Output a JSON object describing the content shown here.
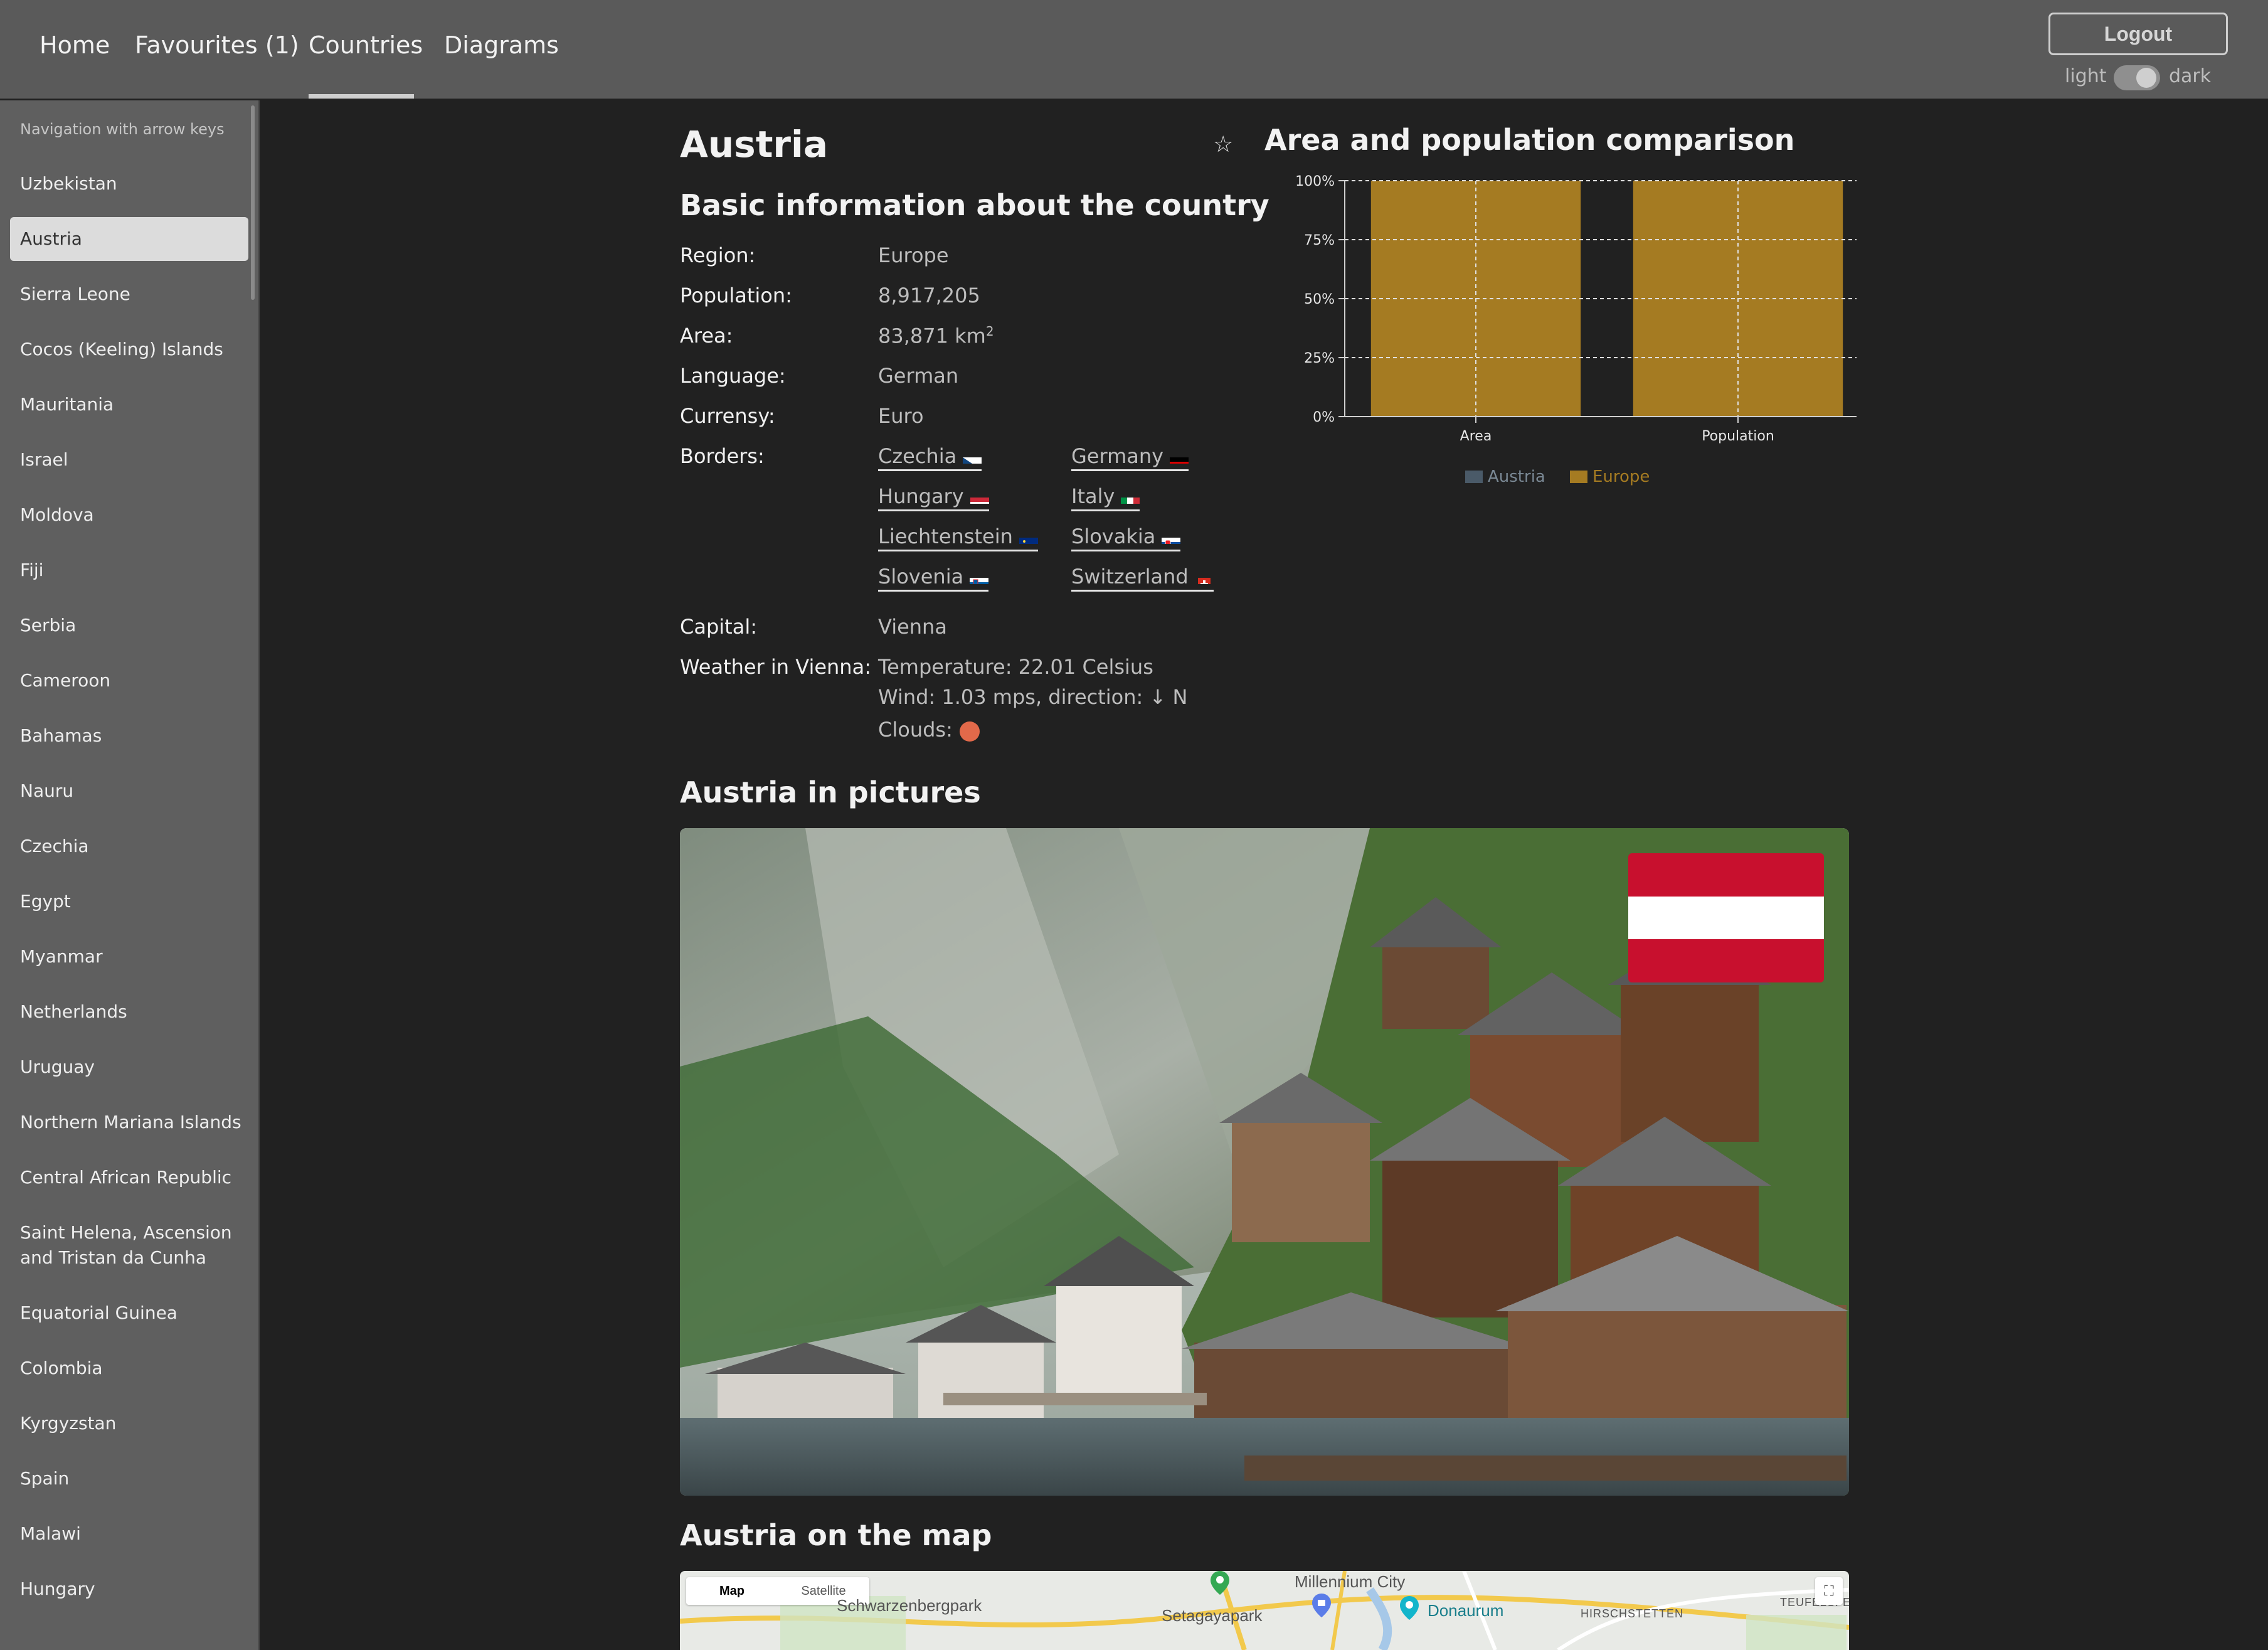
{
  "nav": {
    "tabs": [
      {
        "label": "Home"
      },
      {
        "label": "Favourites (1)"
      },
      {
        "label": "Countries",
        "active": true
      },
      {
        "label": "Diagrams"
      }
    ],
    "logout_label": "Logout",
    "theme_light": "light",
    "theme_dark": "dark"
  },
  "sidebar": {
    "hint": "Navigation with arrow keys",
    "items": [
      {
        "label": "Uzbekistan"
      },
      {
        "label": "Austria",
        "selected": true
      },
      {
        "label": "Sierra Leone"
      },
      {
        "label": "Cocos (Keeling) Islands"
      },
      {
        "label": "Mauritania"
      },
      {
        "label": "Israel"
      },
      {
        "label": "Moldova"
      },
      {
        "label": "Fiji"
      },
      {
        "label": "Serbia"
      },
      {
        "label": "Cameroon"
      },
      {
        "label": "Bahamas"
      },
      {
        "label": "Nauru"
      },
      {
        "label": "Czechia"
      },
      {
        "label": "Egypt"
      },
      {
        "label": "Myanmar"
      },
      {
        "label": "Netherlands"
      },
      {
        "label": "Uruguay"
      },
      {
        "label": "Northern Mariana Islands"
      },
      {
        "label": "Central African Republic"
      },
      {
        "label": "Saint Helena, Ascension and Tristan da Cunha"
      },
      {
        "label": "Equatorial Guinea"
      },
      {
        "label": "Colombia"
      },
      {
        "label": "Kyrgyzstan"
      },
      {
        "label": "Spain"
      },
      {
        "label": "Malawi"
      },
      {
        "label": "Hungary"
      }
    ]
  },
  "country": {
    "name": "Austria",
    "basic_heading": "Basic information about the country",
    "region_label": "Region:",
    "region": "Europe",
    "population_label": "Population:",
    "population": "8,917,205",
    "area_label": "Area:",
    "area": "83,871 km",
    "area_unit_sup": "2",
    "language_label": "Language:",
    "language": "German",
    "currency_label": "Currensy:",
    "currency": "Euro",
    "borders_label": "Borders:",
    "borders": [
      {
        "name": "Czechia"
      },
      {
        "name": "Germany"
      },
      {
        "name": "Hungary"
      },
      {
        "name": "Italy"
      },
      {
        "name": "Liechtenstein"
      },
      {
        "name": "Slovakia"
      },
      {
        "name": "Slovenia"
      },
      {
        "name": "Switzerland"
      }
    ],
    "capital_label": "Capital:",
    "capital": "Vienna",
    "weather_label": "Weather in Vienna:",
    "temperature": "Temperature: 22.01 Celsius",
    "wind": "Wind: 1.03 mps, direction: ↓ N",
    "clouds": "Clouds:",
    "pictures_heading": "Austria in pictures",
    "map_heading": "Austria on the map"
  },
  "map": {
    "btn_map": "Map",
    "btn_satellite": "Satellite",
    "labels": [
      "Schwarzenbergpark",
      "Setagayapark",
      "Millennium City",
      "Donaurum",
      "HIRSCHSTETTEN",
      "TEUFELSFE"
    ]
  },
  "chart_data": {
    "type": "bar",
    "title": "Area and population comparison",
    "categories": [
      "Area",
      "Population"
    ],
    "series": [
      {
        "name": "Austria",
        "values": [
          0.8,
          1.0
        ],
        "color": "#4a5a68"
      },
      {
        "name": "Europe",
        "values": [
          100,
          100
        ],
        "color": "#a57b22"
      }
    ],
    "ylim": [
      0,
      100
    ],
    "yticks": [
      "0%",
      "25%",
      "50%",
      "75%",
      "100%"
    ],
    "grid": true,
    "legend": "bottom"
  }
}
